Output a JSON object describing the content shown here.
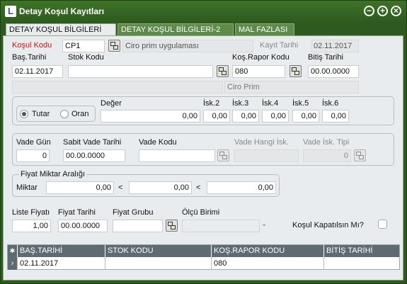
{
  "window": {
    "title": "Detay Koşul Kayıtları",
    "logo_letter": "L"
  },
  "window_buttons": {
    "minimize": "−",
    "maximize": "+",
    "close": "×"
  },
  "tabs": [
    {
      "label": "DETAY KOŞUL BİLGİLERİ"
    },
    {
      "label": "DETAY KOŞUL BİLGİLERİ-2"
    },
    {
      "label": "MAL FAZLASI"
    }
  ],
  "form": {
    "kosul_kodu_label": "Koşul Kodu",
    "kosul_kodu_value": "CP1",
    "kosul_desc": "Ciro prim uygulaması",
    "kayit_tarihi_label": "Kayıt Tarihi",
    "kayit_tarihi_value": "02.11.2017",
    "bas_tarihi_label": "Baş.Tarihi",
    "bas_tarihi_value": "02.11.2017",
    "stok_kodu_label": "Stok Kodu",
    "stok_kodu_value": "",
    "kos_rapor_kodu_label": "Koş.Rapor Kodu",
    "kos_rapor_kodu_value": "080",
    "bitis_tarihi_label": "Bitiş Tarihi",
    "bitis_tarihi_value": "00.00.0000",
    "rapor_desc": "Ciro Prim"
  },
  "discount": {
    "tutar_label": "Tutar",
    "oran_label": "Oran",
    "deger_label": "Değer",
    "deger_value": "0,00",
    "isk2_label": "İsk.2",
    "isk2_value": "0,00",
    "isk3_label": "İsk.3",
    "isk3_value": "0,00",
    "isk4_label": "İsk.4",
    "isk4_value": "0,00",
    "isk5_label": "İsk.5",
    "isk5_value": "0,00",
    "isk6_label": "İsk.6",
    "isk6_value": "0,00"
  },
  "vade": {
    "vade_gun_label": "Vade Gün",
    "vade_gun_value": "0",
    "sabit_vade_label": "Sabit Vade Tarihi",
    "sabit_vade_value": "00.00.0000",
    "vade_kodu_label": "Vade Kodu",
    "vade_kodu_value": "",
    "vade_hangi_isk_label": "Vade Hangi İsk.",
    "vade_hangi_isk_value": "",
    "vade_isk_tipi_label": "Vade İsk. Tipi",
    "vade_isk_tipi_value": "0"
  },
  "fiyat": {
    "group_label": "Fiyat Miktar Aralığı",
    "miktar_label": "Miktar",
    "v1": "0,00",
    "lt1": "<",
    "v2": "0,00",
    "lt2": "<",
    "v3": "0,00"
  },
  "bottom": {
    "liste_fiyati_label": "Liste Fiyatı",
    "liste_fiyati_value": "1,00",
    "fiyat_tarihi_label": "Fiyat Tarihi",
    "fiyat_tarihi_value": "00.00.0000",
    "fiyat_grubu_label": "Fiyat Grubu",
    "fiyat_grubu_value": "",
    "olcu_birimi_label": "Ölçü Birimi",
    "olcu_birimi_value": "",
    "kosul_kapatilsin_label": "Koşul Kapatılsın Mı?"
  },
  "grid": {
    "columns": [
      "BAŞ.TARİHİ",
      "STOK KODU",
      "KOŞ.RAPOR KODU",
      "BİTİŞ TARİHİ"
    ],
    "rows": [
      [
        "02.11.2017",
        "",
        "080",
        ""
      ]
    ]
  }
}
